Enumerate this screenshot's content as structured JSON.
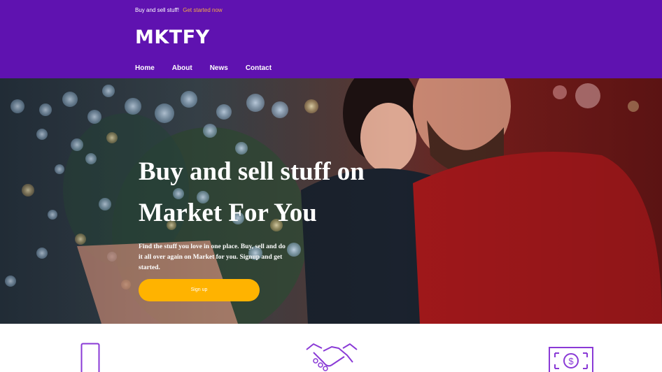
{
  "header": {
    "tagline": "Buy and sell stuff!",
    "tagline_link": "Get started now",
    "logo": "MKTFY",
    "nav": [
      "Home",
      "About",
      "News",
      "Contact"
    ]
  },
  "hero": {
    "title": "Buy and sell stuff on Market For You",
    "description": "Find the stuff you love in one place. Buy, sell and do it all over again on Market for you. Signup and get started.",
    "cta": "Sign up"
  },
  "features": {
    "icons": [
      "phone-icon",
      "handshake-icon",
      "money-icon"
    ]
  },
  "colors": {
    "brand": "#5f12b0",
    "accent": "#ffb300",
    "link": "#f3a94a",
    "icon": "#8a3ad6"
  }
}
